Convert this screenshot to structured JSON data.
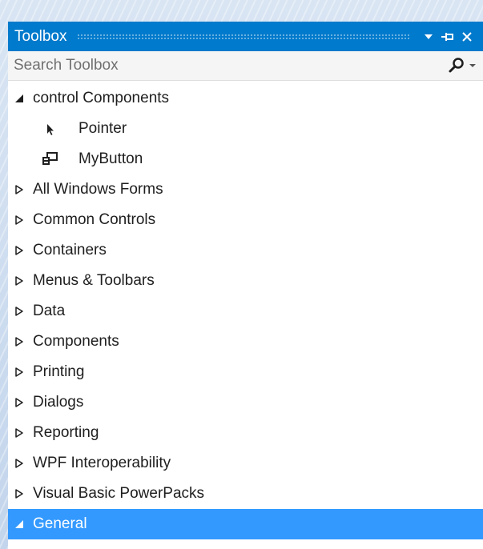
{
  "toolbox": {
    "title": "Toolbox",
    "search_placeholder": "Search Toolbox",
    "groups": [
      {
        "label": "control Components",
        "expanded": true,
        "items": [
          {
            "label": "Pointer",
            "icon": "pointer-arrow-icon"
          },
          {
            "label": "MyButton",
            "icon": "component-icon"
          }
        ]
      },
      {
        "label": "All Windows Forms",
        "expanded": false
      },
      {
        "label": "Common Controls",
        "expanded": false
      },
      {
        "label": "Containers",
        "expanded": false
      },
      {
        "label": "Menus & Toolbars",
        "expanded": false
      },
      {
        "label": "Data",
        "expanded": false
      },
      {
        "label": "Components",
        "expanded": false
      },
      {
        "label": "Printing",
        "expanded": false
      },
      {
        "label": "Dialogs",
        "expanded": false
      },
      {
        "label": "Reporting",
        "expanded": false
      },
      {
        "label": "WPF Interoperability",
        "expanded": false
      },
      {
        "label": "Visual Basic PowerPacks",
        "expanded": false
      },
      {
        "label": "General",
        "expanded": true,
        "selected": true
      }
    ]
  },
  "colors": {
    "title_bar": "#007acc",
    "selection": "#3399ff",
    "panel": "#ffffff",
    "text": "#1e1e1e"
  }
}
